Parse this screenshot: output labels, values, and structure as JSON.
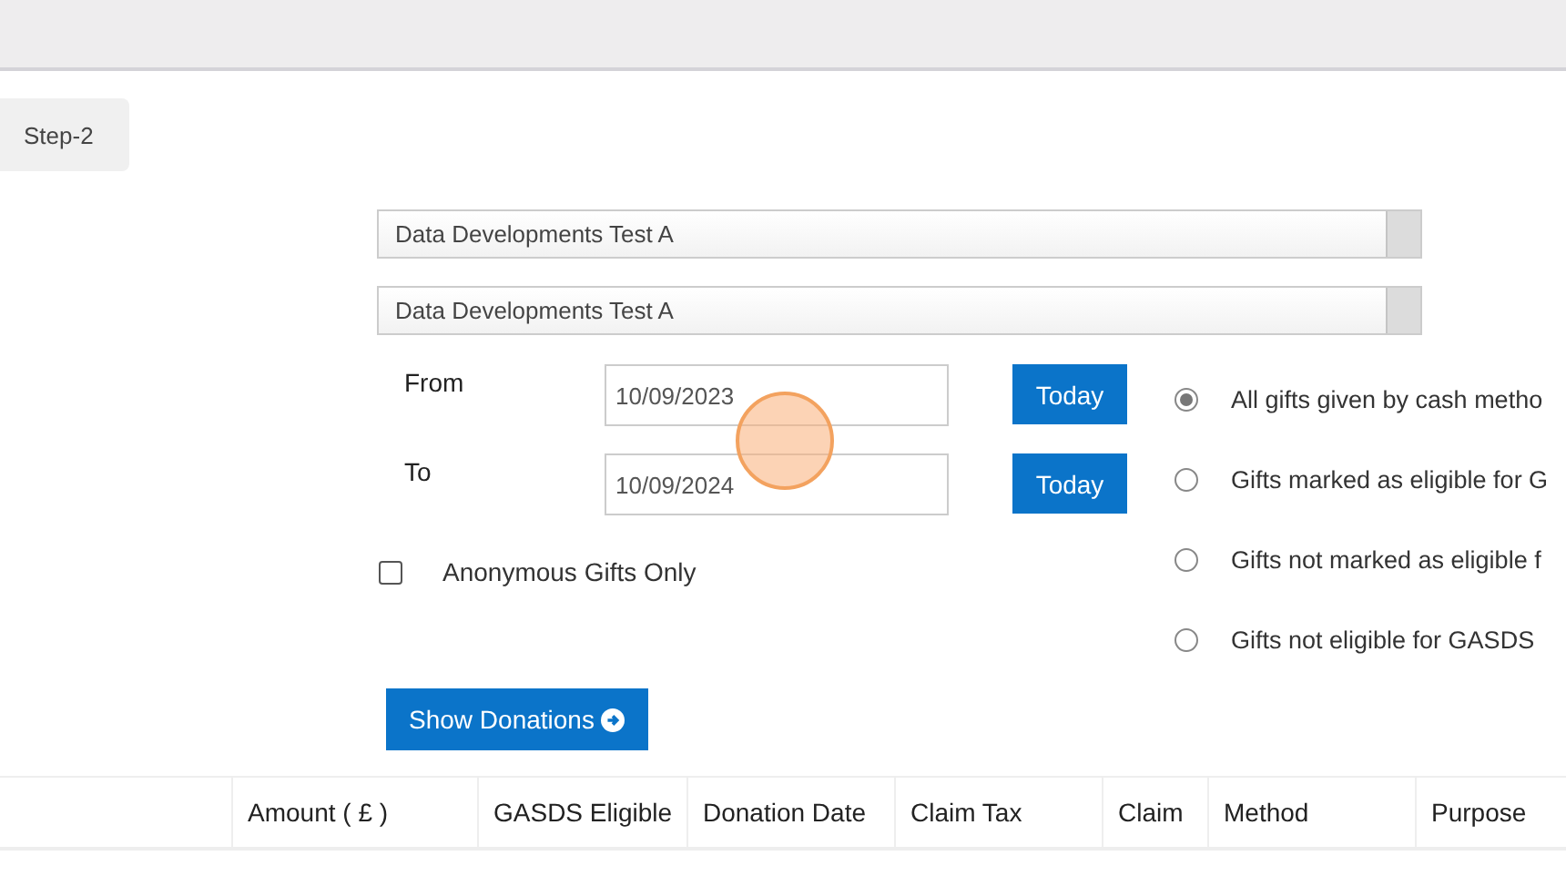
{
  "step_tab": {
    "label": "Step-2"
  },
  "selects": [
    {
      "value": "Data Developments Test A"
    },
    {
      "value": "Data Developments Test A"
    }
  ],
  "dates": [
    {
      "label": "From",
      "value": "10/09/2023",
      "button": "Today"
    },
    {
      "label": "To",
      "value": "10/09/2024",
      "button": "Today"
    }
  ],
  "anonymous": {
    "label": "Anonymous Gifts Only",
    "checked": false
  },
  "options": [
    {
      "label": "All gifts given by cash metho",
      "selected": true
    },
    {
      "label": "Gifts marked as eligible for G",
      "selected": false
    },
    {
      "label": "Gifts not marked as eligible f",
      "selected": false
    },
    {
      "label": "Gifts not eligible for GASDS",
      "selected": false
    }
  ],
  "show_button": {
    "label": "Show Donations"
  },
  "table": {
    "columns": [
      "Amount ( £ )",
      "GASDS Eligible",
      "Donation Date",
      "Claim Tax",
      "Claim",
      "Method",
      "Purpose"
    ]
  }
}
